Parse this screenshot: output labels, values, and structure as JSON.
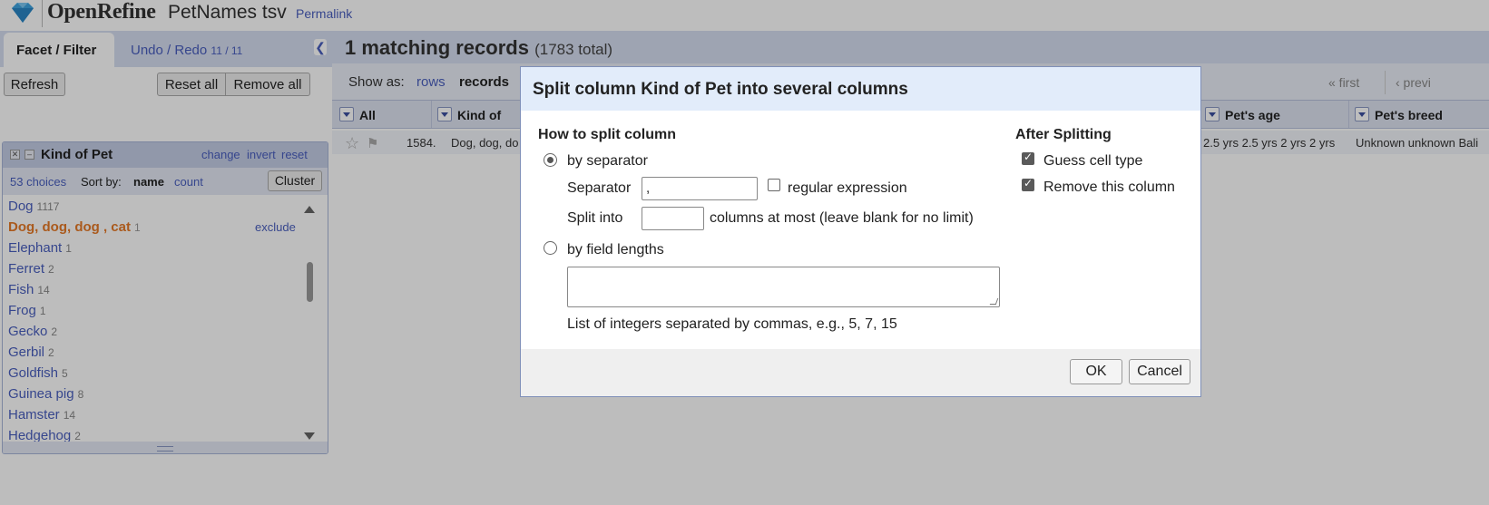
{
  "header": {
    "logo_text": "OpenRefine",
    "project_name": "PetNames tsv",
    "permalink": "Permalink"
  },
  "left": {
    "tab_facet": "Facet / Filter",
    "tab_undo": "Undo / Redo",
    "tab_undo_count": "11 / 11",
    "refresh": "Refresh",
    "reset_all": "Reset all",
    "remove_all": "Remove all",
    "facet": {
      "title": "Kind of Pet",
      "change": "change",
      "invert": "invert",
      "reset": "reset",
      "choices_count": "53 choices",
      "sort_by": "Sort by:",
      "sort_name": "name",
      "sort_count": "count",
      "cluster": "Cluster",
      "exclude": "exclude",
      "items": [
        {
          "label": "Dog",
          "count": "1117"
        },
        {
          "label": "Dog, dog, dog , cat",
          "count": "1"
        },
        {
          "label": "Elephant",
          "count": "1"
        },
        {
          "label": "Ferret",
          "count": "2"
        },
        {
          "label": "Fish",
          "count": "14"
        },
        {
          "label": "Frog",
          "count": "1"
        },
        {
          "label": "Gecko",
          "count": "2"
        },
        {
          "label": "Gerbil",
          "count": "2"
        },
        {
          "label": "Goldfish",
          "count": "5"
        },
        {
          "label": "Guinea pig",
          "count": "8"
        },
        {
          "label": "Hamster",
          "count": "14"
        },
        {
          "label": "Hedgehog",
          "count": "2"
        }
      ]
    }
  },
  "right": {
    "matching": "1 matching records",
    "total": "(1783 total)",
    "show_as": "Show as:",
    "rows": "rows",
    "records": "records",
    "first": "« first",
    "prev": "‹ previ",
    "columns": [
      "All",
      "Kind of",
      "Pet's age",
      "Pet's breed"
    ],
    "row": {
      "index": "1584.",
      "kind": "Dog, dog, do",
      "age": "2.5 yrs 2.5 yrs 2 yrs 2 yrs",
      "breed": "Unknown unknown Bali"
    }
  },
  "dialog": {
    "title": "Split column Kind of Pet into several columns",
    "how_to_split": "How to split column",
    "by_separator": "by separator",
    "separator_label": "Separator",
    "separator_value": ",",
    "regex_label": "regular expression",
    "split_into_label": "Split into",
    "split_into_value": "",
    "split_into_suffix": "columns at most (leave blank for no limit)",
    "by_field_lengths": "by field lengths",
    "field_lengths_hint": "List of integers separated by commas, e.g., 5, 7, 15",
    "after_splitting": "After Splitting",
    "guess_cell_type": "Guess cell type",
    "remove_this_column": "Remove this column",
    "ok": "OK",
    "cancel": "Cancel"
  }
}
